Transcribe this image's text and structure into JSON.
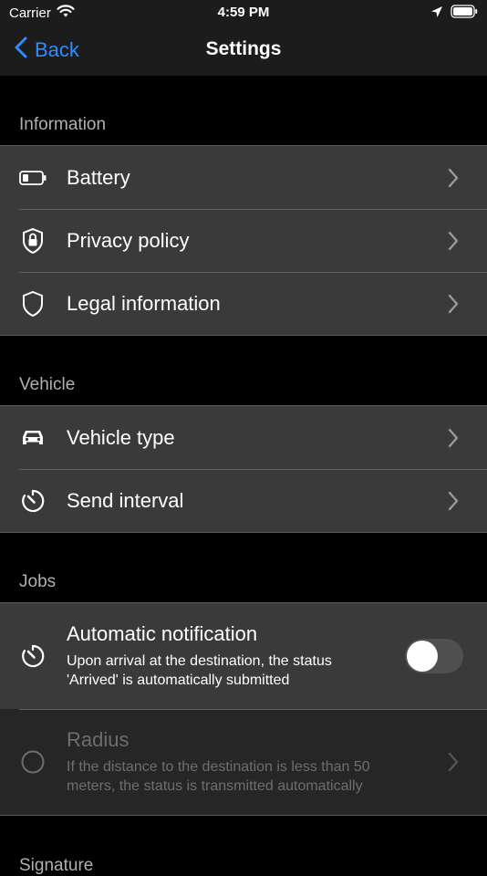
{
  "status_bar": {
    "carrier": "Carrier",
    "time": "4:59 PM"
  },
  "nav": {
    "back_label": "Back",
    "title": "Settings"
  },
  "sections": {
    "information": {
      "header": "Information",
      "items": [
        {
          "label": "Battery",
          "icon": "battery-icon"
        },
        {
          "label": "Privacy policy",
          "icon": "shield-lock-icon"
        },
        {
          "label": "Legal information",
          "icon": "shield-icon"
        }
      ]
    },
    "vehicle": {
      "header": "Vehicle",
      "items": [
        {
          "label": "Vehicle type",
          "icon": "car-icon"
        },
        {
          "label": "Send interval",
          "icon": "timer-icon"
        }
      ]
    },
    "jobs": {
      "header": "Jobs",
      "auto_notification": {
        "title": "Automatic notification",
        "description": "Upon arrival at the destination, the status 'Arrived' is automatically submitted",
        "enabled": false
      },
      "radius": {
        "title": "Radius",
        "description": "If the distance to the destination is less than 50 meters, the status is transmitted automatically"
      }
    },
    "signature": {
      "header": "Signature"
    }
  },
  "colors": {
    "accent": "#2f8cff",
    "row_bg": "#3a3a3a",
    "page_bg": "#000000"
  }
}
